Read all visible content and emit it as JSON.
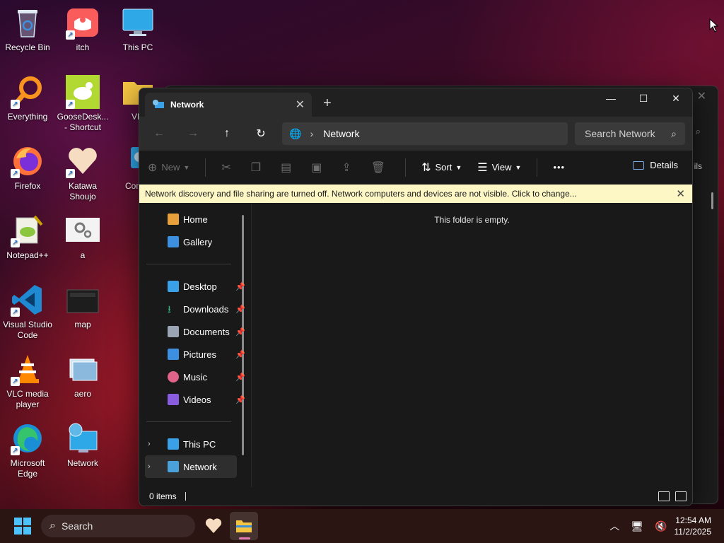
{
  "desktop": {
    "icons": [
      {
        "label": "Recycle Bin"
      },
      {
        "label": "itch"
      },
      {
        "label": "This PC"
      },
      {
        "label": "Everything"
      },
      {
        "label": "GooseDesk... - Shortcut"
      },
      {
        "label": "VM"
      },
      {
        "label": "Firefox"
      },
      {
        "label": "Katawa Shoujo"
      },
      {
        "label": "Contro"
      },
      {
        "label": "Notepad++"
      },
      {
        "label": "a"
      },
      {
        "label": "Visual Studio Code"
      },
      {
        "label": "map"
      },
      {
        "label": "VLC media player"
      },
      {
        "label": "aero"
      },
      {
        "label": "Microsoft Edge"
      },
      {
        "label": "Network"
      }
    ]
  },
  "background_window": {
    "partial_text": "ils"
  },
  "explorer": {
    "tab_title": "Network",
    "address_path": "Network",
    "search_placeholder": "Search Network",
    "commands": {
      "new_label": "New",
      "sort_label": "Sort",
      "view_label": "View",
      "more_label": "•••",
      "details_label": "Details"
    },
    "infobar_text": "Network discovery and file sharing are turned off. Network computers and devices are not visible. Click to change...",
    "sidebar": {
      "top": [
        {
          "label": "Home",
          "color": "#e8a13a"
        },
        {
          "label": "Gallery",
          "color": "#3d8fe0"
        }
      ],
      "pinned": [
        {
          "label": "Desktop",
          "color": "#3aa0e8"
        },
        {
          "label": "Downloads",
          "color": "#36b37e"
        },
        {
          "label": "Documents",
          "color": "#9aa4b2"
        },
        {
          "label": "Pictures",
          "color": "#3d8fe0"
        },
        {
          "label": "Music",
          "color": "#e0648a"
        },
        {
          "label": "Videos",
          "color": "#8a5ce0"
        }
      ],
      "tree": [
        {
          "label": "This PC",
          "color": "#3aa0e8"
        },
        {
          "label": "Network",
          "color": "#4aa0d8"
        }
      ]
    },
    "empty_message": "This folder is empty.",
    "status_text": "0 items"
  },
  "taskbar": {
    "search_placeholder": "Search",
    "time": "12:54 AM",
    "date": "11/2/2025"
  },
  "colors": {
    "accent": "#4cc2ff",
    "infobar_bg": "#fdf7c6"
  }
}
